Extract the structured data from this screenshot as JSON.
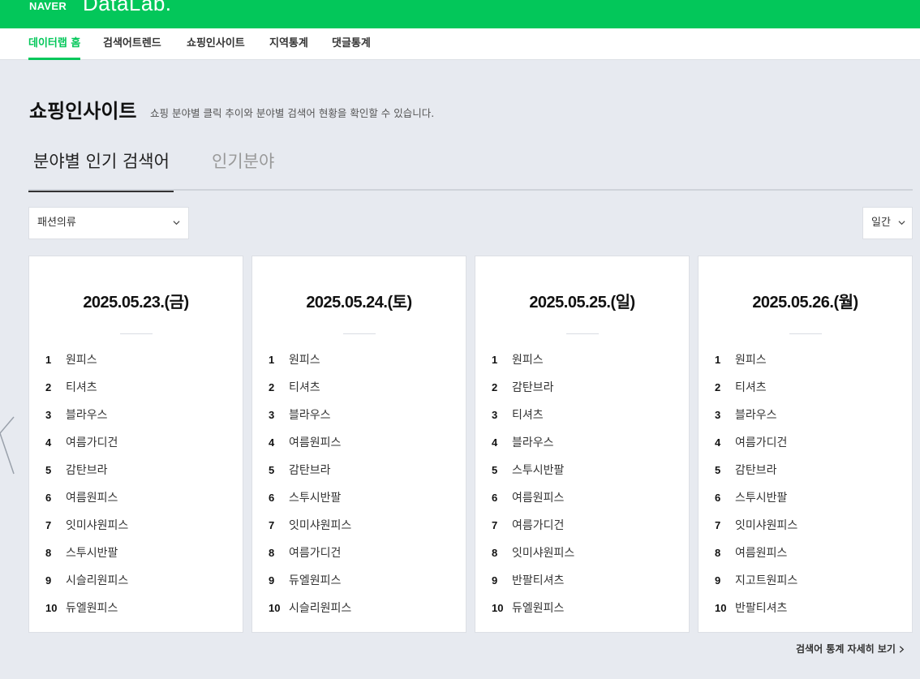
{
  "header": {
    "naver_label": "NAVER",
    "datalab_label": "DataLab.",
    "brand_color": "#03c75a"
  },
  "gnb": {
    "items": [
      {
        "label": "데이터랩 홈",
        "active": true
      },
      {
        "label": "검색어트렌드",
        "active": false
      },
      {
        "label": "쇼핑인사이트",
        "active": false
      },
      {
        "label": "지역통계",
        "active": false
      },
      {
        "label": "댓글통계",
        "active": false
      }
    ]
  },
  "page": {
    "title": "쇼핑인사이트",
    "description": "쇼핑 분야별 클릭 추이와 분야별 검색어 현황을 확인할 수 있습니다."
  },
  "tabs": [
    {
      "label": "분야별 인기 검색어",
      "active": true
    },
    {
      "label": "인기분야",
      "active": false
    }
  ],
  "filters": {
    "category": "패션의류",
    "period": "일간"
  },
  "cards": [
    {
      "date": "2025.05.23.(금)",
      "ranks": [
        {
          "num": "1",
          "keyword": "원피스"
        },
        {
          "num": "2",
          "keyword": "티셔츠"
        },
        {
          "num": "3",
          "keyword": "블라우스"
        },
        {
          "num": "4",
          "keyword": "여름가디건"
        },
        {
          "num": "5",
          "keyword": "감탄브라"
        },
        {
          "num": "6",
          "keyword": "여름원피스"
        },
        {
          "num": "7",
          "keyword": "잇미샤원피스"
        },
        {
          "num": "8",
          "keyword": "스투시반팔"
        },
        {
          "num": "9",
          "keyword": "시슬리원피스"
        },
        {
          "num": "10",
          "keyword": "듀엘원피스"
        }
      ]
    },
    {
      "date": "2025.05.24.(토)",
      "ranks": [
        {
          "num": "1",
          "keyword": "원피스"
        },
        {
          "num": "2",
          "keyword": "티셔츠"
        },
        {
          "num": "3",
          "keyword": "블라우스"
        },
        {
          "num": "4",
          "keyword": "여름원피스"
        },
        {
          "num": "5",
          "keyword": "감탄브라"
        },
        {
          "num": "6",
          "keyword": "스투시반팔"
        },
        {
          "num": "7",
          "keyword": "잇미샤원피스"
        },
        {
          "num": "8",
          "keyword": "여름가디건"
        },
        {
          "num": "9",
          "keyword": "듀엘원피스"
        },
        {
          "num": "10",
          "keyword": "시슬리원피스"
        }
      ]
    },
    {
      "date": "2025.05.25.(일)",
      "ranks": [
        {
          "num": "1",
          "keyword": "원피스"
        },
        {
          "num": "2",
          "keyword": "감탄브라"
        },
        {
          "num": "3",
          "keyword": "티셔츠"
        },
        {
          "num": "4",
          "keyword": "블라우스"
        },
        {
          "num": "5",
          "keyword": "스투시반팔"
        },
        {
          "num": "6",
          "keyword": "여름원피스"
        },
        {
          "num": "7",
          "keyword": "여름가디건"
        },
        {
          "num": "8",
          "keyword": "잇미샤원피스"
        },
        {
          "num": "9",
          "keyword": "반팔티셔츠"
        },
        {
          "num": "10",
          "keyword": "듀엘원피스"
        }
      ]
    },
    {
      "date": "2025.05.26.(월)",
      "ranks": [
        {
          "num": "1",
          "keyword": "원피스"
        },
        {
          "num": "2",
          "keyword": "티셔츠"
        },
        {
          "num": "3",
          "keyword": "블라우스"
        },
        {
          "num": "4",
          "keyword": "여름가디건"
        },
        {
          "num": "5",
          "keyword": "감탄브라"
        },
        {
          "num": "6",
          "keyword": "스투시반팔"
        },
        {
          "num": "7",
          "keyword": "잇미샤원피스"
        },
        {
          "num": "8",
          "keyword": "여름원피스"
        },
        {
          "num": "9",
          "keyword": "지고트원피스"
        },
        {
          "num": "10",
          "keyword": "반팔티셔츠"
        }
      ]
    }
  ],
  "more_link": "검색어 통계 자세히 보기"
}
